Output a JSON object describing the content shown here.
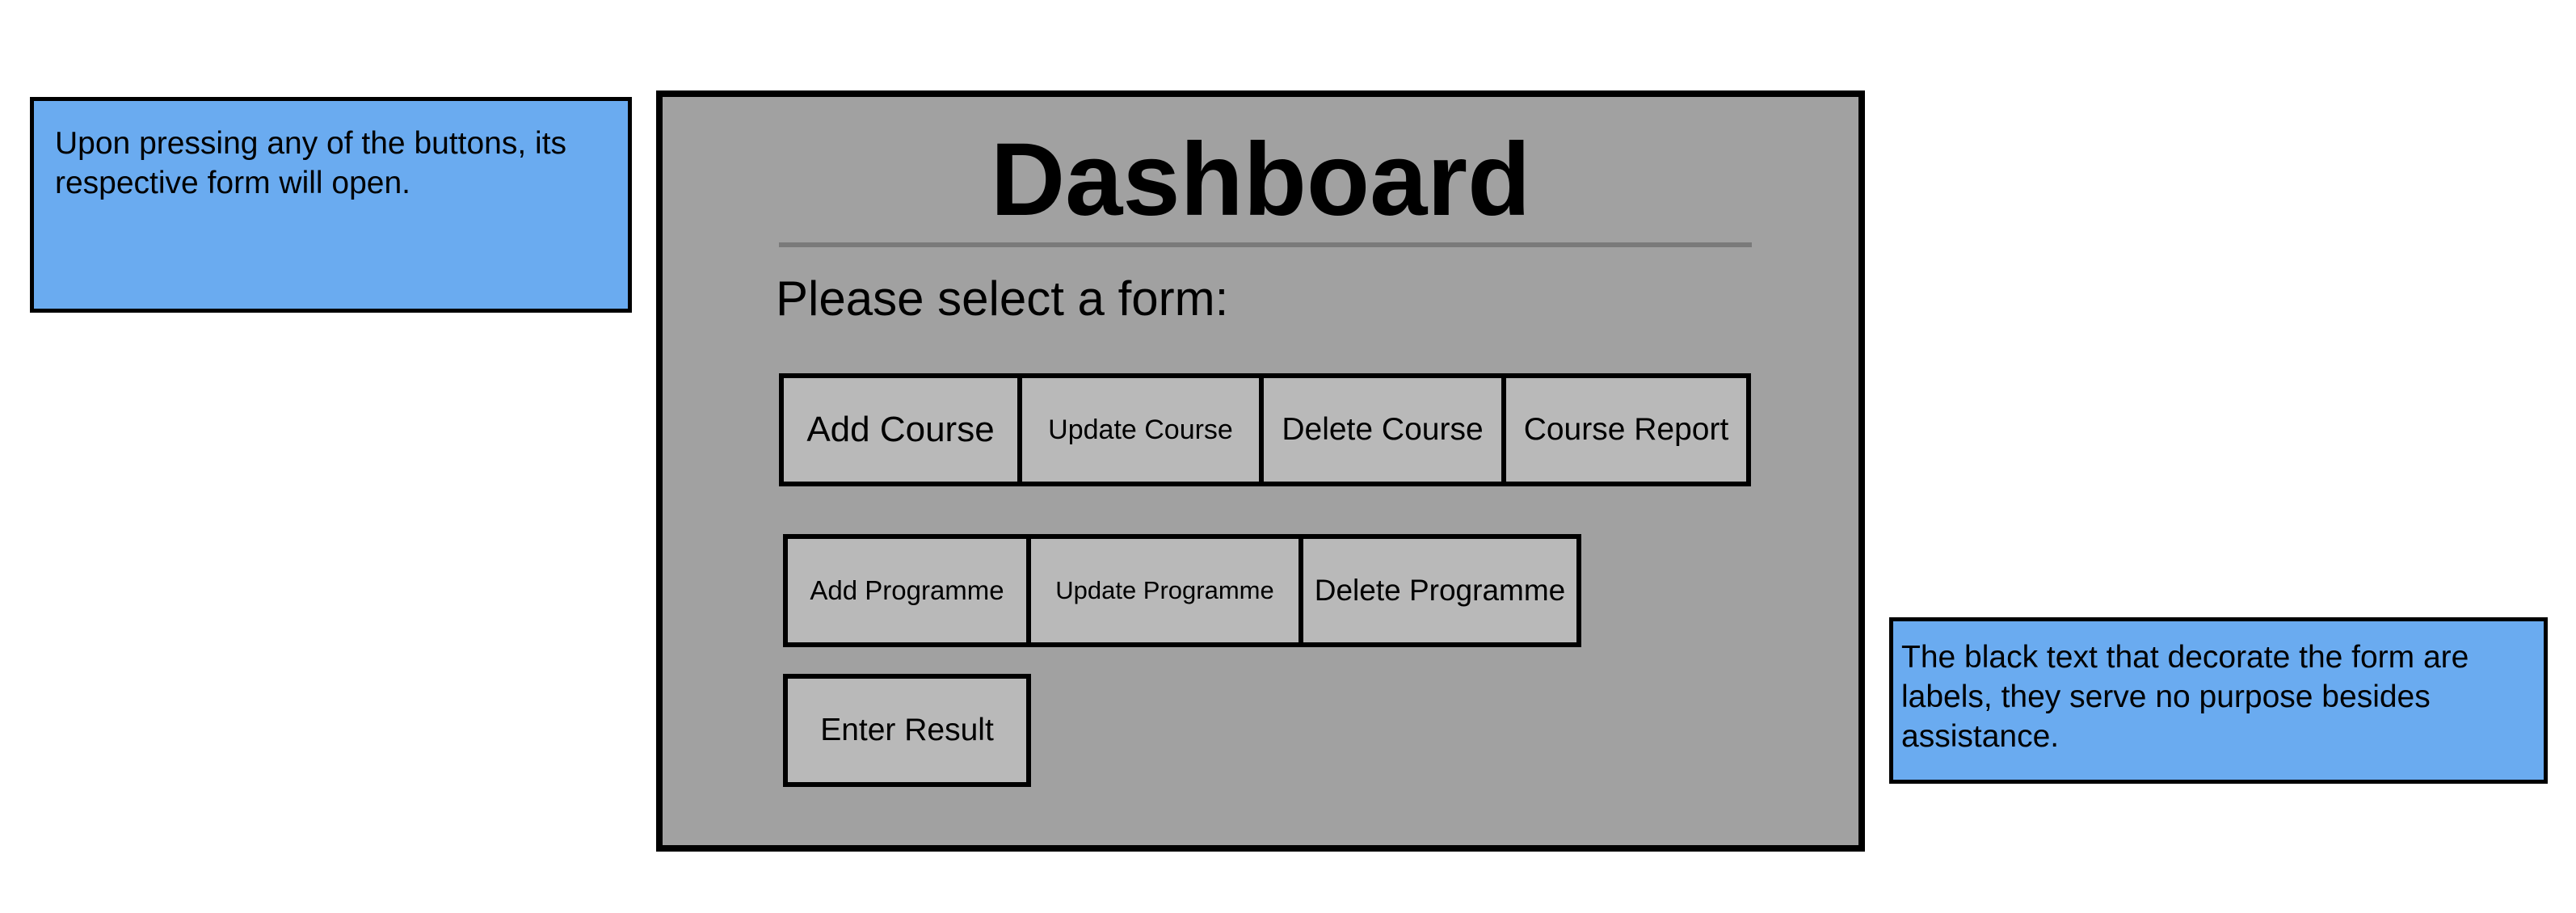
{
  "notes": {
    "left": "Upon pressing any of the buttons, its respective form will open.",
    "right": "The black text that decorate the form are labels, they serve no purpose besides assistance."
  },
  "dashboard": {
    "title": "Dashboard",
    "prompt": "Please select a form:",
    "buttons": {
      "add_course": "Add Course",
      "update_course": "Update Course",
      "delete_course": "Delete Course",
      "course_report": "Course Report",
      "add_programme": "Add Programme",
      "update_programme": "Update Programme",
      "delete_programme": "Delete Programme",
      "enter_result": "Enter Result"
    }
  },
  "colors": {
    "note_fill": "#6aabf0",
    "window_fill": "#a1a1a1",
    "button_fill": "#b9b9b9",
    "divider": "#7a7a7a",
    "border": "#000000"
  }
}
